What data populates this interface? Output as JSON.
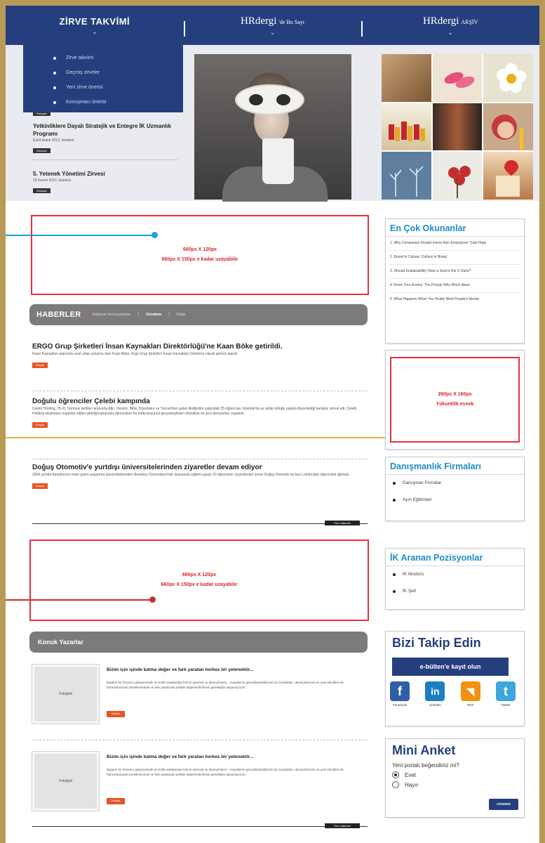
{
  "nav": {
    "item1": "ZİRVE TAKVİMİ",
    "item2_brand": "HRdergi",
    "item2_suffix": "'de Bu Sayı",
    "item3_brand": "HRdergi",
    "item3_suffix": "ARŞİV"
  },
  "dropdown": [
    "Zirve takvimi",
    "Geçmiş zirveler",
    "Yeni zirve önerisi",
    "Konuşmacı önerisi"
  ],
  "events": {
    "top_button": "Detaylar",
    "items": [
      {
        "title": "Yetkinliklere Dayalı Stratejik ve Entegre İK Uzmanlık Programı",
        "meta": "Eylül-Aralık 2010, İstanbul",
        "button": "Detaylar"
      },
      {
        "title": "5. Yetenek Yönetimi Zirvesi",
        "meta": "29 Kasım 2010, İstanbul",
        "button": "Detaylar"
      }
    ]
  },
  "ads": {
    "top": {
      "line1": "660px X 120px",
      "line2": "660px X 150px e kadar uzayabilir"
    },
    "side": {
      "line1": "260px X 160px",
      "line2": "Yükseklik esnek"
    },
    "mid": {
      "line1": "660px X 120px",
      "line2": "660px X 150px e kadar uzayabilir"
    }
  },
  "news_tabs": {
    "main": "HABERLER",
    "star": "•",
    "tab1": "Haftanın konuşulanları",
    "tab2": "Gündem",
    "tab3": "Kitap",
    "sep": "|"
  },
  "news": [
    {
      "title": "ERGO Grup Şirketleri İnsan Kaynakları Direktörlüğü'ne Kaan Böke getirildi.",
      "text": "İnsan Kaynakları alanında uzun yıllar çalışmış olan Kaan Böke, Ergo Grup Şirketleri İnsan Kaynakları Direktörü olarak göreve atandı.",
      "button": "Detaylar"
    },
    {
      "title": "Doğulu öğrenciler Çelebi kampında",
      "text": "Çelebi Holding, 25-31 Temmuz tarihleri arasında Ağrı, Dersim, Bitlis, Diyarbakır ve Tunceli'den gelen ilköğretim çağındaki 25 öğrenciye, İstanbul'da ve sahip olduğu yapıda düzenlediği kampta, konuk etti. Çelebi Holding tarafından organize edilen işbirliği kampında öğrencilere bu hafta boyunca gerçekleştirilen etkinlikler ile yeni deneyimler yaşatıldı.",
      "button": "Detaylar"
    },
    {
      "title": "Doğuş Otomotiv'e yurtdışı üniversitelerinden ziyaretler devam ediyor",
      "text": "2009 yılında Amerika'nın önde gelen araştırma üniversitelerinden Berkeley Üniversitesi'nde lisansüstü eğitimi yapan 20 öğrencinin ziyaretinden sonra Doğuş Otomotiv bu kez Londra'dan öğrencileri ağırladı.",
      "button": "Detaylar"
    }
  ],
  "more_news": "Tüm Haberler",
  "guest": {
    "header": "Konuk Yazarlar",
    "items": [
      {
        "photo": "Fotoğraf",
        "title": "Bizim için işinde katma değer ve fark yaratan herkes bir yetenektir...",
        "text": "Başarılı bir firmanın gelişmesinde en kritik noktalardan birinin yetenek ve deneyimlerin... Hayallerini gerçekleştirebilmek için kurdukları, deneyimlerinin en yeni teknikleri ile harmanlanarak yönetilmesinde ve fark yaratacak şekilde değerlendirilmesi gerektiğini düşünüyorum.",
        "button": "Detaylar"
      },
      {
        "photo": "Fotoğraf",
        "title": "Bizim için işinde katma değer ve fark yaratan herkes bir yetenektir...",
        "text": "Başarılı bir firmanın gelişmesinde en kritik noktalardan birinin yetenek ve deneyimlerin... Hayallerini gerçekleştirebilmek için kurdukları, deneyimlerinin en yeni teknikleri ile harmanlanarak yönetilmesinde ve fark yaratacak şekilde değerlendirilmesi gerektiğini düşünüyorum.",
        "button": "Detaylar"
      }
    ],
    "more": "Tüm Haberler"
  },
  "most_read": {
    "title": "En Çok Okunanlar",
    "items": [
      "1. Why Companies Should Invest their Employees' Total Hope",
      "2. Brand In Culture, Culture In Brand",
      "3. Should Sustainability Have a Seat in the C-Suite?",
      "4. Know Your Enemy: The People Who Block Ideas",
      "5. What Happens When You Really Meet People's Needs"
    ]
  },
  "consulting": {
    "title": "Danışmanlık Firmaları",
    "items": [
      "Danışman Firmalar",
      "Ayın Eğitimleri"
    ]
  },
  "positions": {
    "title": "İK Aranan Pozisyonlar",
    "items": [
      "İK Müdürü",
      "İK Şefi"
    ]
  },
  "follow": {
    "title": "Bizi Takip Edin",
    "subscribe": "e-bülten'e kayıt olun",
    "social": [
      {
        "glyph": "f",
        "label": "Facebook",
        "color": "#2f5fa6"
      },
      {
        "glyph": "in",
        "label": "LinkedIn",
        "color": "#1b7ec2"
      },
      {
        "glyph": "◥",
        "label": "RSS",
        "color": "#f29111"
      },
      {
        "glyph": "t",
        "label": "Twitter",
        "color": "#3fa6dd"
      }
    ]
  },
  "poll": {
    "title": "Mini Anket",
    "question": "Yeni portalı beğendiniz mi?",
    "options": [
      "Evet",
      "Hayır"
    ],
    "selected": "Evet",
    "button": "GÖNDER"
  },
  "colors": {
    "navy": "#253f7e",
    "frame": "#b89a57",
    "ad_border": "#e3333a",
    "annot_blue": "#15a1e0",
    "annot_gold": "#e7b143",
    "annot_red": "#c4312f"
  }
}
